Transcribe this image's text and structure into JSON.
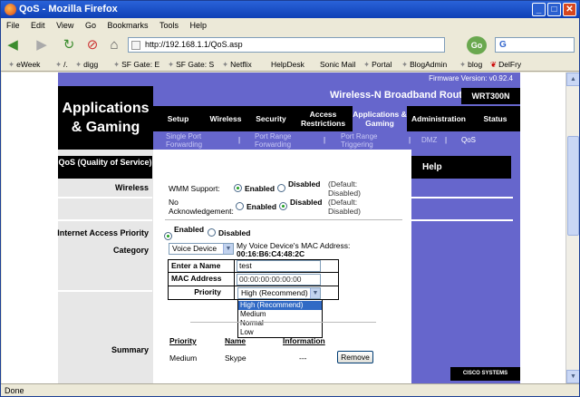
{
  "window": {
    "title": "QoS - Mozilla Firefox"
  },
  "menu": [
    "File",
    "Edit",
    "View",
    "Go",
    "Bookmarks",
    "Tools",
    "Help"
  ],
  "nav": {
    "url": "http://192.168.1.1/QoS.asp",
    "search_label": "G"
  },
  "bookmarks": [
    "eWeek",
    "/.",
    "digg",
    "SF Gate: E",
    "SF Gate: S",
    "Netflix",
    "HelpDesk",
    "Sonic Mail",
    "Portal",
    "BlogAdmin",
    "blog",
    "DelFry"
  ],
  "router": {
    "firmware": "Firmware Version: v0.92.4",
    "section_title": "Applications & Gaming",
    "product": "Wireless-N Broadband Router",
    "model": "WRT300N",
    "tabs": [
      "Setup",
      "Wireless",
      "Security",
      "Access Restrictions",
      "Applications & Gaming",
      "Administration",
      "Status"
    ],
    "subtabs": [
      "Single Port Forwarding",
      "Port Range Forwarding",
      "Port Range Triggering",
      "DMZ",
      "QoS"
    ],
    "subtab_sep": "|"
  },
  "side": {
    "heading": "QoS (Quality of Service)",
    "wireless": "Wireless",
    "iap": "Internet Access Priority",
    "category": "Category",
    "summary": "Summary"
  },
  "wireless": {
    "wmm_label": "WMM Support:",
    "wmm_enabled": "Enabled",
    "wmm_disabled": "Disabled",
    "wmm_default": "(Default: Disabled)",
    "noack_label": "No Acknowledgement:",
    "noack_enabled": "Enabled",
    "noack_disabled": "Disabled",
    "noack_default": "(Default: Disabled)"
  },
  "iap": {
    "enabled": "Enabled",
    "disabled": "Disabled"
  },
  "category": {
    "selected": "Voice Device",
    "mac_caption": "My Voice Device's MAC Address:",
    "mac_value": "00:16:B6:C4:48:2C",
    "name_label": "Enter a Name",
    "name_value": "test",
    "mac_label": "MAC Address",
    "mac_field": "00:00:00:00:00:00",
    "priority_label": "Priority",
    "priority_selected": "High (Recommend)",
    "options": [
      "High (Recommend)",
      "Medium",
      "Normal",
      "Low"
    ]
  },
  "summary": {
    "headers": [
      "Priority",
      "Name",
      "Information"
    ],
    "rows": [
      {
        "priority": "Medium",
        "name": "Skype",
        "info": "---",
        "action": "Remove"
      }
    ]
  },
  "help": {
    "title": "Help",
    "brand": "CISCO SYSTEMS"
  },
  "status": "Done"
}
